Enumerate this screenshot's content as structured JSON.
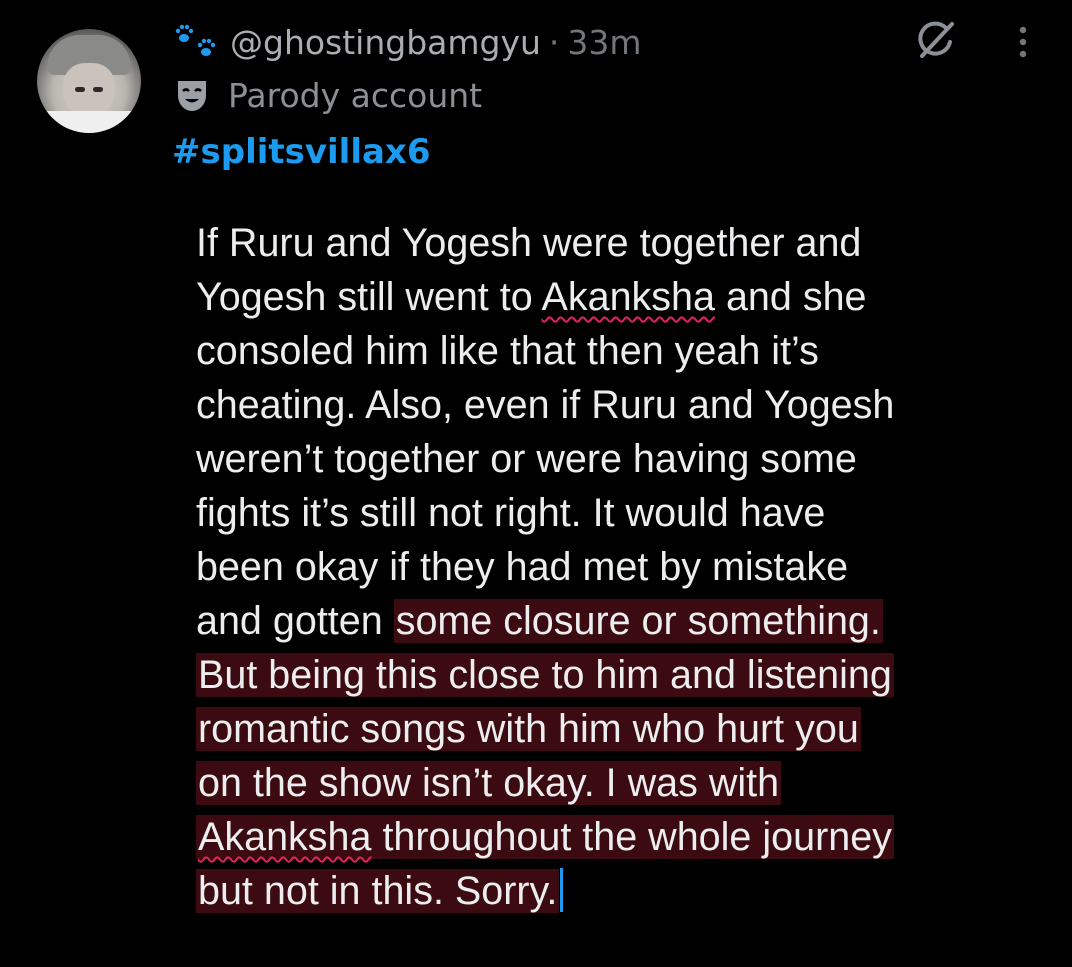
{
  "post": {
    "handle": "@ghostingbamgyu",
    "separator": "·",
    "time": "33m",
    "account_label": "Parody account",
    "hashtag": "#splitsvillax6",
    "body_lines": [
      {
        "pre": "If Ruru and Yogesh were together and",
        "hl": ""
      },
      {
        "pre": "Yogesh still went to ",
        "squiggle": "Akanksha",
        "post": " and she",
        "hl": ""
      },
      {
        "pre": "consoled him like that then yeah it’s",
        "hl": ""
      },
      {
        "pre": "cheating. Also, even if Ruru and Yogesh",
        "hl": ""
      },
      {
        "pre": "weren’t together or were having some",
        "hl": ""
      },
      {
        "pre": "fights it’s still not right. It would have",
        "hl": ""
      },
      {
        "pre": "been okay if they had met by mistake",
        "hl": ""
      },
      {
        "pre": "and gotten ",
        "hl": "some closure or something."
      },
      {
        "pre": "",
        "hl": "But being this close to him and listening"
      },
      {
        "pre": "",
        "hl": "romantic songs with him who hurt you"
      },
      {
        "pre": "",
        "hl": "on the show isn’t okay. I was with"
      },
      {
        "pre": "",
        "hl_squiggle": "Akanksha",
        "hl": " throughout the whole journey"
      },
      {
        "pre": "",
        "hl": "but not in this. Sorry."
      }
    ]
  },
  "icons": {
    "badge": "paw-prints-icon",
    "parody": "theater-mask-icon",
    "grok": "grok-icon",
    "more": "more-options-icon"
  },
  "colors": {
    "background": "#000000",
    "link": "#1d9bf0",
    "highlight": "#3b0b11",
    "spellcheck": "#e0245e"
  }
}
